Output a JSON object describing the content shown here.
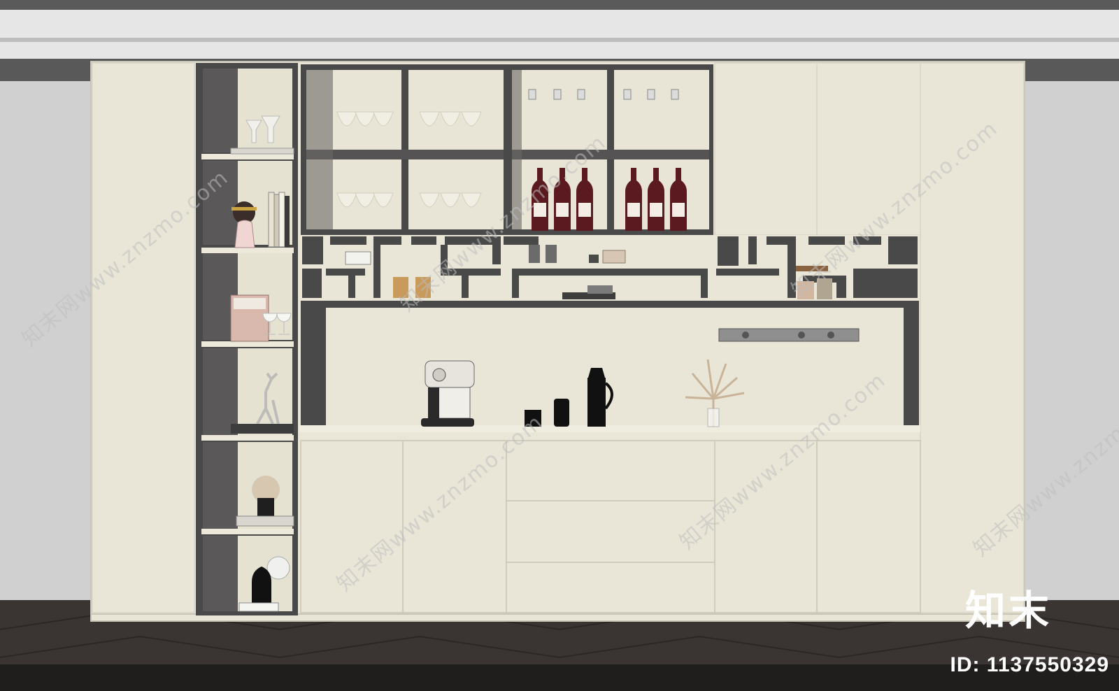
{
  "scene": {
    "subject": "wine-and-coffee-bar-cabinet-render",
    "colors": {
      "wall": "#d0d0d0",
      "ceiling": "#e6e6e6",
      "frame": "#4a4949",
      "cabinet": "#e9e6d7",
      "floor": "#3a3533",
      "wine": "#5a1a20"
    }
  },
  "watermark": {
    "site_text": "知末网www.znzmo.com"
  },
  "branding": {
    "mark": "知末",
    "id_text": "ID: 1137550329"
  }
}
